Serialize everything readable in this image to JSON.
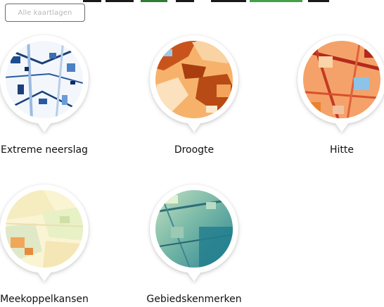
{
  "filter": {
    "label": "Alle kaartlagen"
  },
  "tiles": [
    {
      "label": "Extreme neerslag",
      "theme": "blue"
    },
    {
      "label": "Droogte",
      "theme": "orange"
    },
    {
      "label": "Hitte",
      "theme": "red-orange"
    },
    {
      "label": "Meekoppelkansen",
      "theme": "pastel"
    },
    {
      "label": "Gebiedskenmerken",
      "theme": "teal"
    }
  ]
}
